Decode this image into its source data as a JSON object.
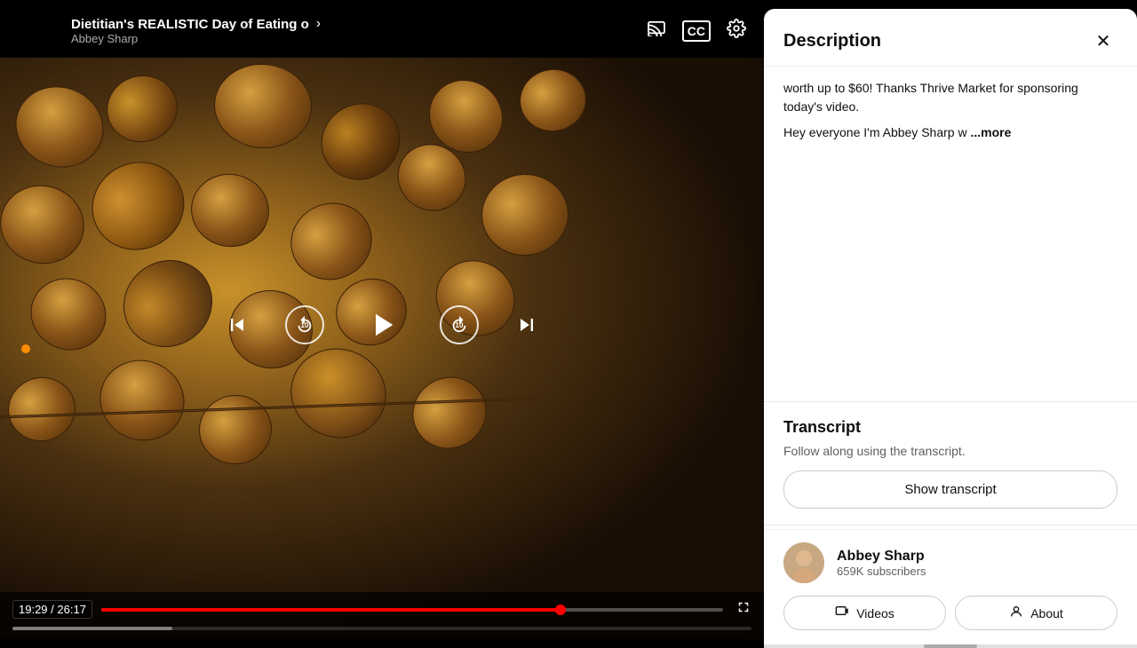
{
  "page": {
    "background_color": "#000000"
  },
  "topbar": {
    "video_title": "Dietitian's REALISTIC Day of Eating o",
    "channel_name": "Abbey Sharp",
    "chevron_label": "›",
    "cast_icon": "📡",
    "cc_icon": "CC",
    "settings_icon": "⚙"
  },
  "video": {
    "current_time": "19:29",
    "total_time": "26:17",
    "progress_percent": 73.8
  },
  "description_panel": {
    "title": "Description",
    "close_label": "✕",
    "text_line1": "worth up to $60! Thanks Thrive Market for sponsoring today's video.",
    "text_line2": "Hey everyone I'm Abbey Sharp w",
    "more_label": "...more",
    "transcript": {
      "title": "Transcript",
      "description": "Follow along using the transcript.",
      "show_button_label": "Show transcript"
    },
    "channel": {
      "name": "Abbey Sharp",
      "subscribers": "659K subscribers",
      "videos_button": "Videos",
      "about_button": "About"
    }
  }
}
